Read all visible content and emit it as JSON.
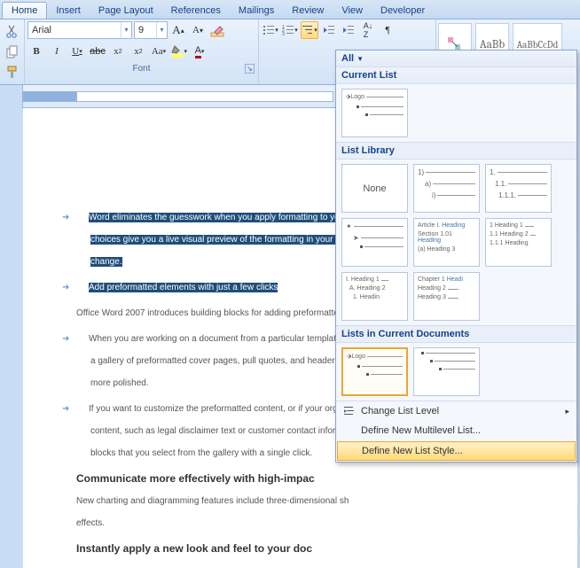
{
  "tabs": [
    "Home",
    "Insert",
    "Page Layout",
    "References",
    "Mailings",
    "Review",
    "View",
    "Developer"
  ],
  "font": {
    "name": "Arial",
    "size": "9",
    "group_label": "Font"
  },
  "dd": {
    "all": "All",
    "current": "Current List",
    "library": "List Library",
    "none": "None",
    "in_docs": "Lists in Current Documents",
    "change": "Change List Level",
    "multi": "Define New Multilevel List...",
    "style": "Define New List Style..."
  },
  "tiles": {
    "logo": "Logo",
    "t1": [
      "1)",
      "a)",
      "i)"
    ],
    "t2": [
      "1.",
      "1.1.",
      "1.1.1."
    ],
    "t3": [
      "Article I.",
      "Section 1.01",
      "(a) Heading 3"
    ],
    "t3b": [
      "Heading",
      "Heading",
      "Heading"
    ],
    "t4": [
      "1 Heading 1",
      "1.1 Heading 2",
      "1.1.1 Heading"
    ],
    "t5": [
      "I. Heading 1",
      "A. Heading 2",
      "1. Headin"
    ],
    "t6": [
      "Chapter 1",
      "Heading 2",
      "Heading 3"
    ],
    "t6b": "Headi"
  },
  "styles": {
    "aab": "AaBb",
    "aabc": "AaBbCcDd"
  },
  "doc": {
    "p1a": "Word eliminates the guesswork when you apply formatting to yo",
    "p1b": "choices give you a live visual preview of the formatting in your do",
    "p1c": "change.",
    "p2": "Add preformatted elements with just a few clicks",
    "p3": "Office Word 2007 introduces building blocks for adding preformatted c",
    "p4": "When you are working on a document from a particular template",
    "p4b": "a gallery of preformatted cover pages, pull quotes, and headers a",
    "p4c": "more polished.",
    "p5": "If you want to customize the preformatted content, or if your orga",
    "p5b": "content, such as legal disclaimer text or customer contact inform",
    "p5c": "blocks that you select from the gallery with a single click.",
    "h1": "Communicate more effectively with high-impac",
    "p6": "New charting and diagramming features include three-dimensional sh",
    "p6b": "effects.",
    "h2": "Instantly apply a new look and feel to your doc"
  }
}
